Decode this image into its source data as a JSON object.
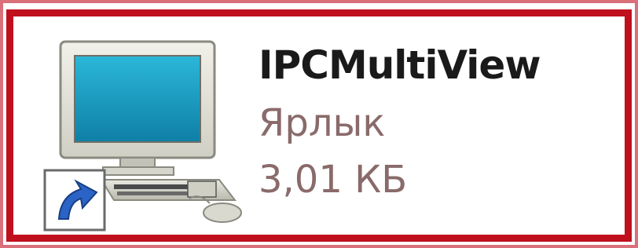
{
  "file": {
    "name": "IPCMultiView",
    "type": "Ярлык",
    "size": "3,01 КБ",
    "icon": "computer-shortcut-icon"
  },
  "colors": {
    "frame_border": "#c0101e",
    "frame_glow": "#d9707a",
    "name_text": "#1a1a1a",
    "meta_text": "#8a6a6a",
    "screen": "#1aa5c9"
  }
}
